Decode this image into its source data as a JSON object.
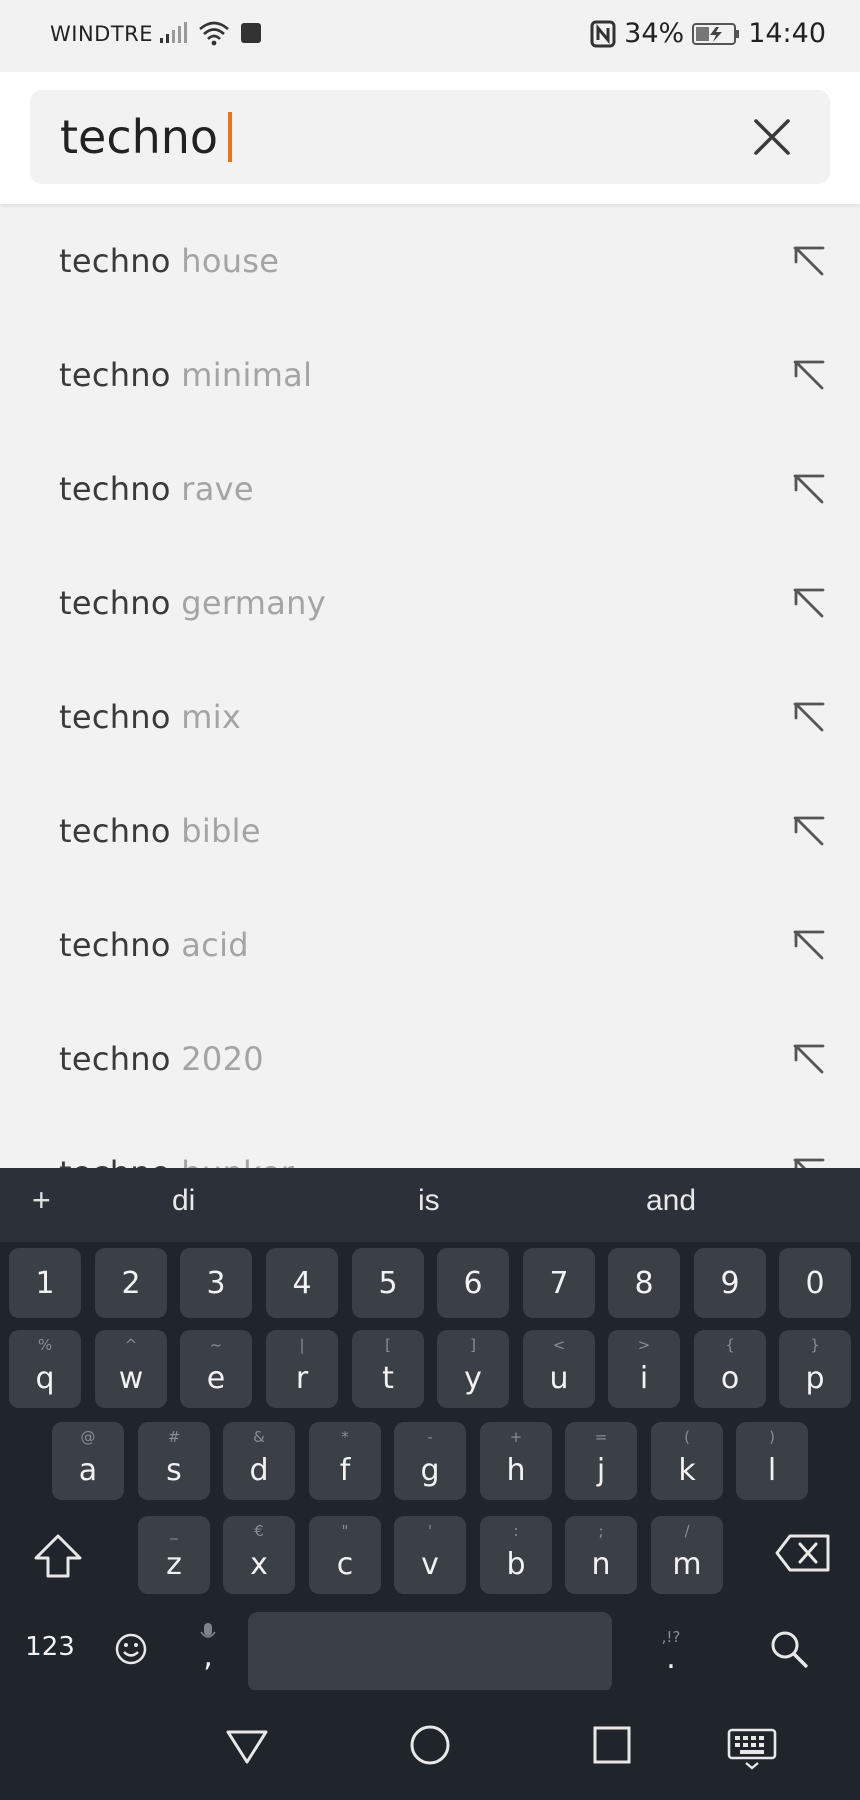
{
  "status_bar": {
    "carrier": "WINDTRE",
    "battery": "34%",
    "time": "14:40",
    "icons": [
      "signal-icon",
      "wifi-icon",
      "notification-icon",
      "nfc-icon",
      "battery-icon"
    ]
  },
  "search": {
    "query": "techno",
    "clear_icon": "close-icon",
    "caret_color": "#e8731f"
  },
  "suggestions": [
    {
      "typed": "techno",
      "completion": "house"
    },
    {
      "typed": "techno",
      "completion": "minimal"
    },
    {
      "typed": "techno",
      "completion": "rave"
    },
    {
      "typed": "techno",
      "completion": "germany"
    },
    {
      "typed": "techno",
      "completion": "mix"
    },
    {
      "typed": "techno",
      "completion": "bible"
    },
    {
      "typed": "techno",
      "completion": "acid"
    },
    {
      "typed": "techno",
      "completion": "2020"
    },
    {
      "typed": "techno",
      "completion": "bunker"
    }
  ],
  "keyboard": {
    "plus": "+",
    "word_suggestions": [
      "di",
      "is",
      "and"
    ],
    "numbers": [
      "1",
      "2",
      "3",
      "4",
      "5",
      "6",
      "7",
      "8",
      "9",
      "0"
    ],
    "row1": [
      {
        "main": "q",
        "alt": "%"
      },
      {
        "main": "w",
        "alt": "^"
      },
      {
        "main": "e",
        "alt": "~"
      },
      {
        "main": "r",
        "alt": "|"
      },
      {
        "main": "t",
        "alt": "["
      },
      {
        "main": "y",
        "alt": "]"
      },
      {
        "main": "u",
        "alt": "<"
      },
      {
        "main": "i",
        "alt": ">"
      },
      {
        "main": "o",
        "alt": "{"
      },
      {
        "main": "p",
        "alt": "}"
      }
    ],
    "row2": [
      {
        "main": "a",
        "alt": "@"
      },
      {
        "main": "s",
        "alt": "#"
      },
      {
        "main": "d",
        "alt": "&"
      },
      {
        "main": "f",
        "alt": "*"
      },
      {
        "main": "g",
        "alt": "-"
      },
      {
        "main": "h",
        "alt": "+"
      },
      {
        "main": "j",
        "alt": "="
      },
      {
        "main": "k",
        "alt": "("
      },
      {
        "main": "l",
        "alt": ")"
      }
    ],
    "row3": [
      {
        "main": "z",
        "alt": "_"
      },
      {
        "main": "x",
        "alt": "€"
      },
      {
        "main": "c",
        "alt": "\""
      },
      {
        "main": "v",
        "alt": "'"
      },
      {
        "main": "b",
        "alt": ":"
      },
      {
        "main": "n",
        "alt": ";"
      },
      {
        "main": "m",
        "alt": "/"
      }
    ],
    "mode_label": "123",
    "comma": ",",
    "period": ".",
    "period_alt": ",!?"
  }
}
